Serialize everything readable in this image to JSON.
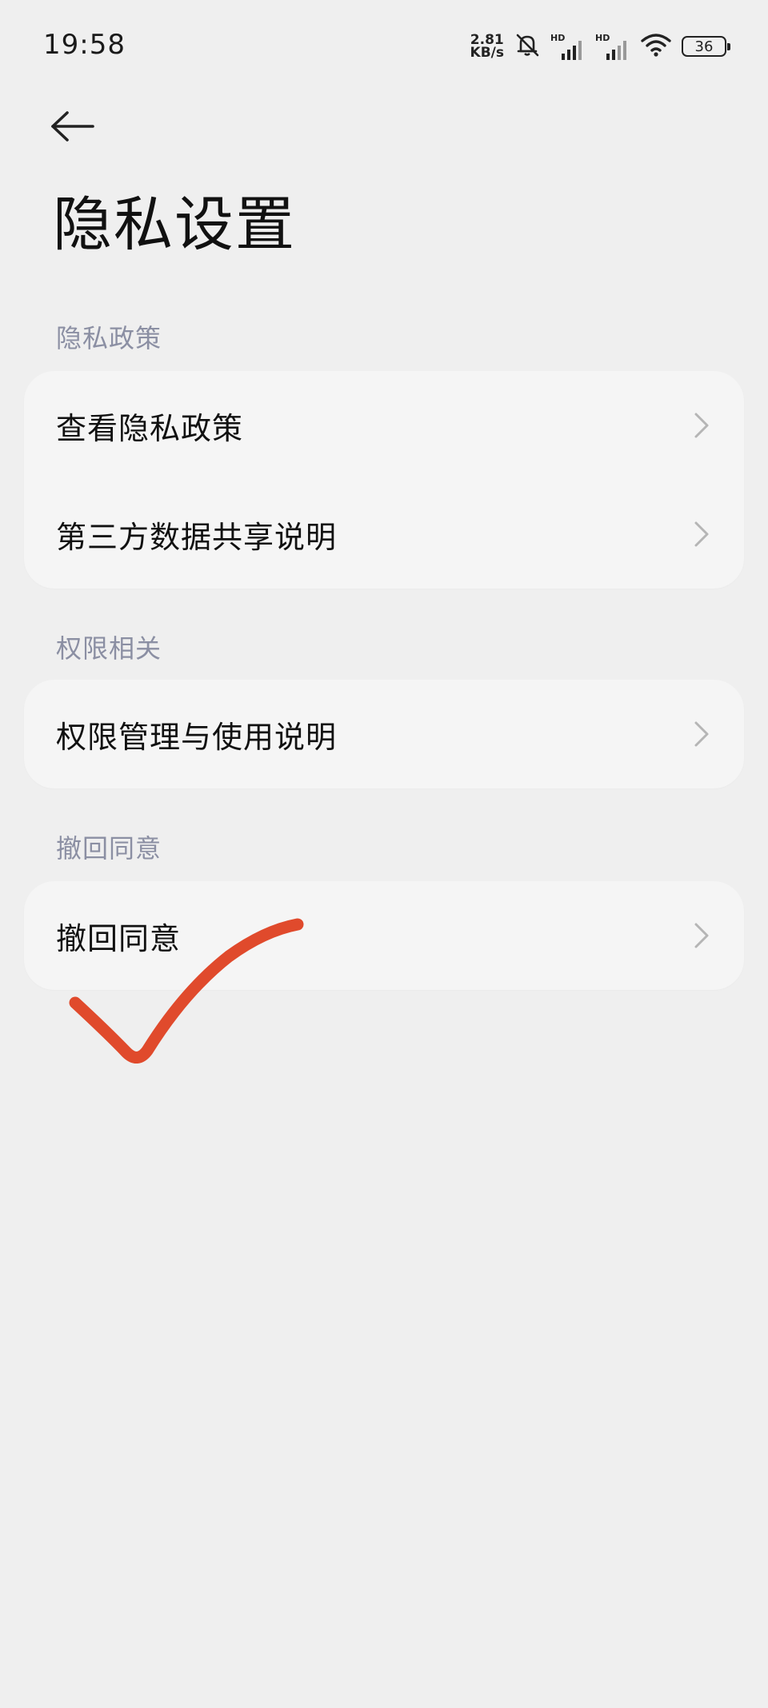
{
  "status_bar": {
    "time": "19:58",
    "net_speed_value": "2.81",
    "net_speed_unit": "KB/s",
    "hd_label_1": "HD",
    "hd_label_2": "HD",
    "battery_level": "36",
    "icons": [
      "mute-bell-icon",
      "cellular-signal-icon",
      "cellular-signal-icon",
      "wifi-icon",
      "battery-icon"
    ]
  },
  "header": {
    "back_icon": "back-arrow-icon",
    "title": "隐私设置"
  },
  "sections": [
    {
      "header": "隐私政策",
      "items": [
        {
          "label": "查看隐私政策"
        },
        {
          "label": "第三方数据共享说明"
        }
      ]
    },
    {
      "header": "权限相关",
      "items": [
        {
          "label": "权限管理与使用说明"
        }
      ]
    },
    {
      "header": "撤回同意",
      "items": [
        {
          "label": "撤回同意"
        }
      ]
    }
  ],
  "annotation": {
    "type": "hand-drawn-checkmark",
    "color": "#e04a2c"
  },
  "colors": {
    "background": "#efefef",
    "card": "#f5f5f5",
    "section_header": "#8b8fa3",
    "chevron": "#b5b5b5"
  }
}
